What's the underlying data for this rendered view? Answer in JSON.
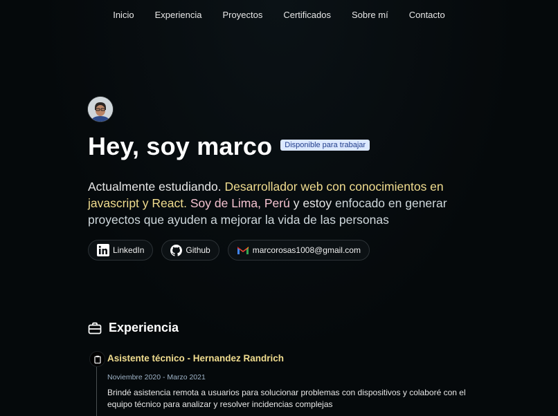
{
  "nav": {
    "items": [
      "Inicio",
      "Experiencia",
      "Proyectos",
      "Certificados",
      "Sobre mí",
      "Contacto"
    ]
  },
  "hero": {
    "title": "Hey, soy marco",
    "badge": "Disponible para trabajar",
    "desc": {
      "p1": "Actualmente estudiando.",
      "p2": "Desarrollador web con conocimientos en javascript y React.",
      "p3": "Soy de Lima,",
      "p4": "Perú",
      "p5": "y estoy",
      "p6": "enfocado en generar proyectos que ayuden a mejorar la vida de las personas"
    }
  },
  "social": {
    "linkedin": "LinkedIn",
    "github": "Github",
    "email": "marcorosas1008@gmail.com"
  },
  "experience": {
    "title": "Experiencia",
    "jobs": [
      {
        "title": "Asistente técnico - Hernandez Randrich",
        "date": "Noviembre 2020 - Marzo 2021",
        "description": "Brindé asistencia remota a usuarios para solucionar problemas con dispositivos y colaboré con el equipo técnico para analizar y resolver incidencias complejas"
      }
    ]
  },
  "colors": {
    "background": "#05090b",
    "accent_yellow": "#f1dd8f",
    "accent_pink": "#f4c2d0",
    "badge_bg": "#dbe8ff",
    "badge_text": "#1f3d8a"
  },
  "icons": {
    "linkedin": "linkedin-icon",
    "github": "github-icon",
    "email": "gmail-icon",
    "experience": "briefcase-icon",
    "timeline": "clipboard-icon"
  }
}
